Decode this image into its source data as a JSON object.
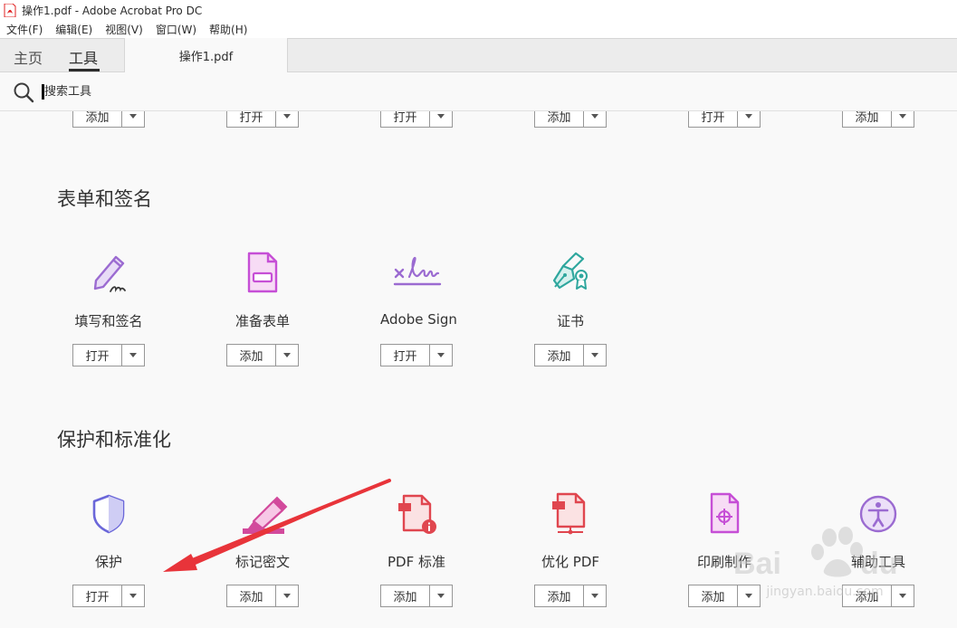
{
  "window": {
    "title": "操作1.pdf - Adobe Acrobat Pro DC"
  },
  "menubar": {
    "items": [
      "文件(F)",
      "编辑(E)",
      "视图(V)",
      "窗口(W)",
      "帮助(H)"
    ]
  },
  "tabs": {
    "home": "主页",
    "tools": "工具",
    "document": "操作1.pdf"
  },
  "search": {
    "placeholder": "搜索工具"
  },
  "top_row_buttons": [
    "添加",
    "打开",
    "打开",
    "添加",
    "打开",
    "添加"
  ],
  "sections": [
    {
      "title": "表单和签名",
      "tools": [
        {
          "label": "填写和签名",
          "button": "打开",
          "icon": "fill-sign-icon"
        },
        {
          "label": "准备表单",
          "button": "添加",
          "icon": "prepare-form-icon"
        },
        {
          "label": "Adobe Sign",
          "button": "打开",
          "icon": "adobe-sign-icon"
        },
        {
          "label": "证书",
          "button": "添加",
          "icon": "certificate-icon"
        }
      ]
    },
    {
      "title": "保护和标准化",
      "tools": [
        {
          "label": "保护",
          "button": "打开",
          "icon": "shield-icon"
        },
        {
          "label": "标记密文",
          "button": "添加",
          "icon": "redact-marker-icon"
        },
        {
          "label": "PDF 标准",
          "button": "添加",
          "icon": "pdf-standard-icon"
        },
        {
          "label": "优化 PDF",
          "button": "添加",
          "icon": "optimize-pdf-icon"
        },
        {
          "label": "印刷制作",
          "button": "添加",
          "icon": "print-production-icon"
        },
        {
          "label": "辅助工具",
          "button": "添加",
          "icon": "accessibility-icon"
        }
      ]
    }
  ],
  "watermark": {
    "text": "jingyan.baidu.com"
  },
  "colors": {
    "purple": "#9b6bd1",
    "teal": "#2fa79e",
    "red": "#e0464f",
    "magenta": "#c64fd6",
    "annotation_arrow": "#e8343a"
  }
}
